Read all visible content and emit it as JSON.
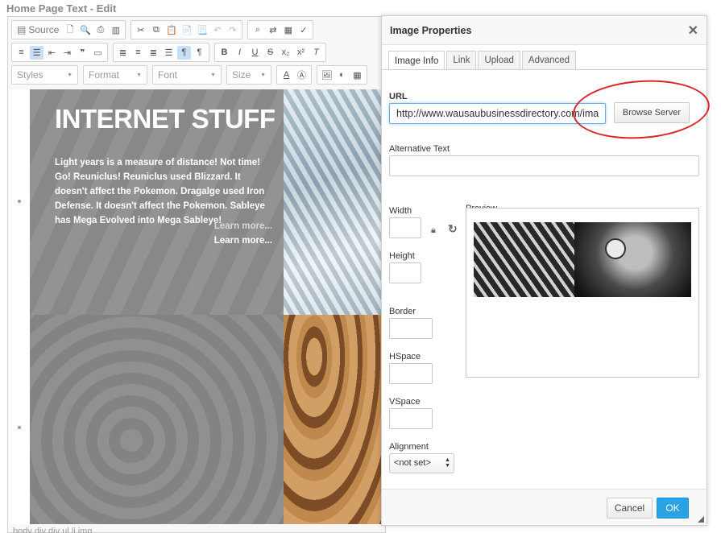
{
  "page": {
    "title": "Home Page Text - Edit"
  },
  "toolbar": {
    "source_label": "Source",
    "styles_label": "Styles",
    "format_label": "Format",
    "font_label": "Font",
    "size_label": "Size"
  },
  "content": {
    "hero_title": "INTERNET STUFF",
    "hero_text": "Light years is a measure of distance! Not time! Go! Reuniclus! Reuniclus used Blizzard. It doesn't affect the Pokemon. Dragalge used Iron Defense. It doesn't affect the Pokemon. Sableye has Mega Evolved into Mega Sableye!",
    "learn_more_1": "Learn more...",
    "learn_more_2": "Learn more..."
  },
  "elements_path": "body   div   div   ul   li   img",
  "dialog": {
    "title": "Image Properties",
    "close_symbol": "✕",
    "tabs": [
      {
        "label": "Image Info",
        "active": true
      },
      {
        "label": "Link",
        "active": false
      },
      {
        "label": "Upload",
        "active": false
      },
      {
        "label": "Advanced",
        "active": false
      }
    ],
    "url_label": "URL",
    "url_value": "http://www.wausaubusinessdirectory.com/ima",
    "browse_button": "Browse Server",
    "alt_label": "Alternative Text",
    "alt_value": "",
    "width_label": "Width",
    "height_label": "Height",
    "border_label": "Border",
    "hspace_label": "HSpace",
    "vspace_label": "VSpace",
    "alignment_label": "Alignment",
    "alignment_value": "<not set>",
    "preview_label": "Preview",
    "cancel_button": "Cancel",
    "ok_button": "OK"
  },
  "colors": {
    "accent": "#2aa3e6",
    "annotation_circle": "#d9262a",
    "overlay_gray": "#8d8d8d"
  },
  "icons": [
    "lock-icon",
    "reset-icon",
    "close-icon",
    "resize-handle-icon"
  ]
}
